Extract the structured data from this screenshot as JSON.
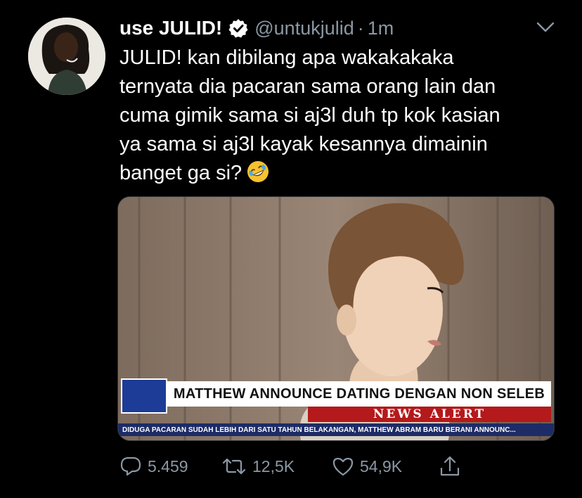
{
  "tweet": {
    "display_name": "use JULID!",
    "handle": "@untukjulid",
    "separator": "·",
    "time": "1m",
    "text_lines": [
      "JULID! kan dibilang apa wakakakaka",
      "ternyata dia pacaran sama orang lain dan",
      "cuma gimik sama si aj3l duh tp kok kasian",
      "ya sama si aj3l kayak kesannya dimainin",
      "banget ga si?"
    ],
    "emoji": "rolling-on-floor-laughing-emoji"
  },
  "media": {
    "headline": "MATTHEW ANNOUNCE DATING DENGAN NON SELEB",
    "alert": "NEWS ALERT",
    "ticker": "DIDUGA PACARAN SUDAH LEBIH DARI SATU TAHUN BELAKANGAN, MATTHEW ABRAM BARU BERANI ANNOUNC..."
  },
  "actions": {
    "replies": "5.459",
    "retweets": "12,5K",
    "likes": "54,9K"
  },
  "colors": {
    "background": "#000000",
    "secondary_text": "#8b98a5",
    "news_blue": "#1d3c97",
    "news_red": "#b4191b"
  }
}
